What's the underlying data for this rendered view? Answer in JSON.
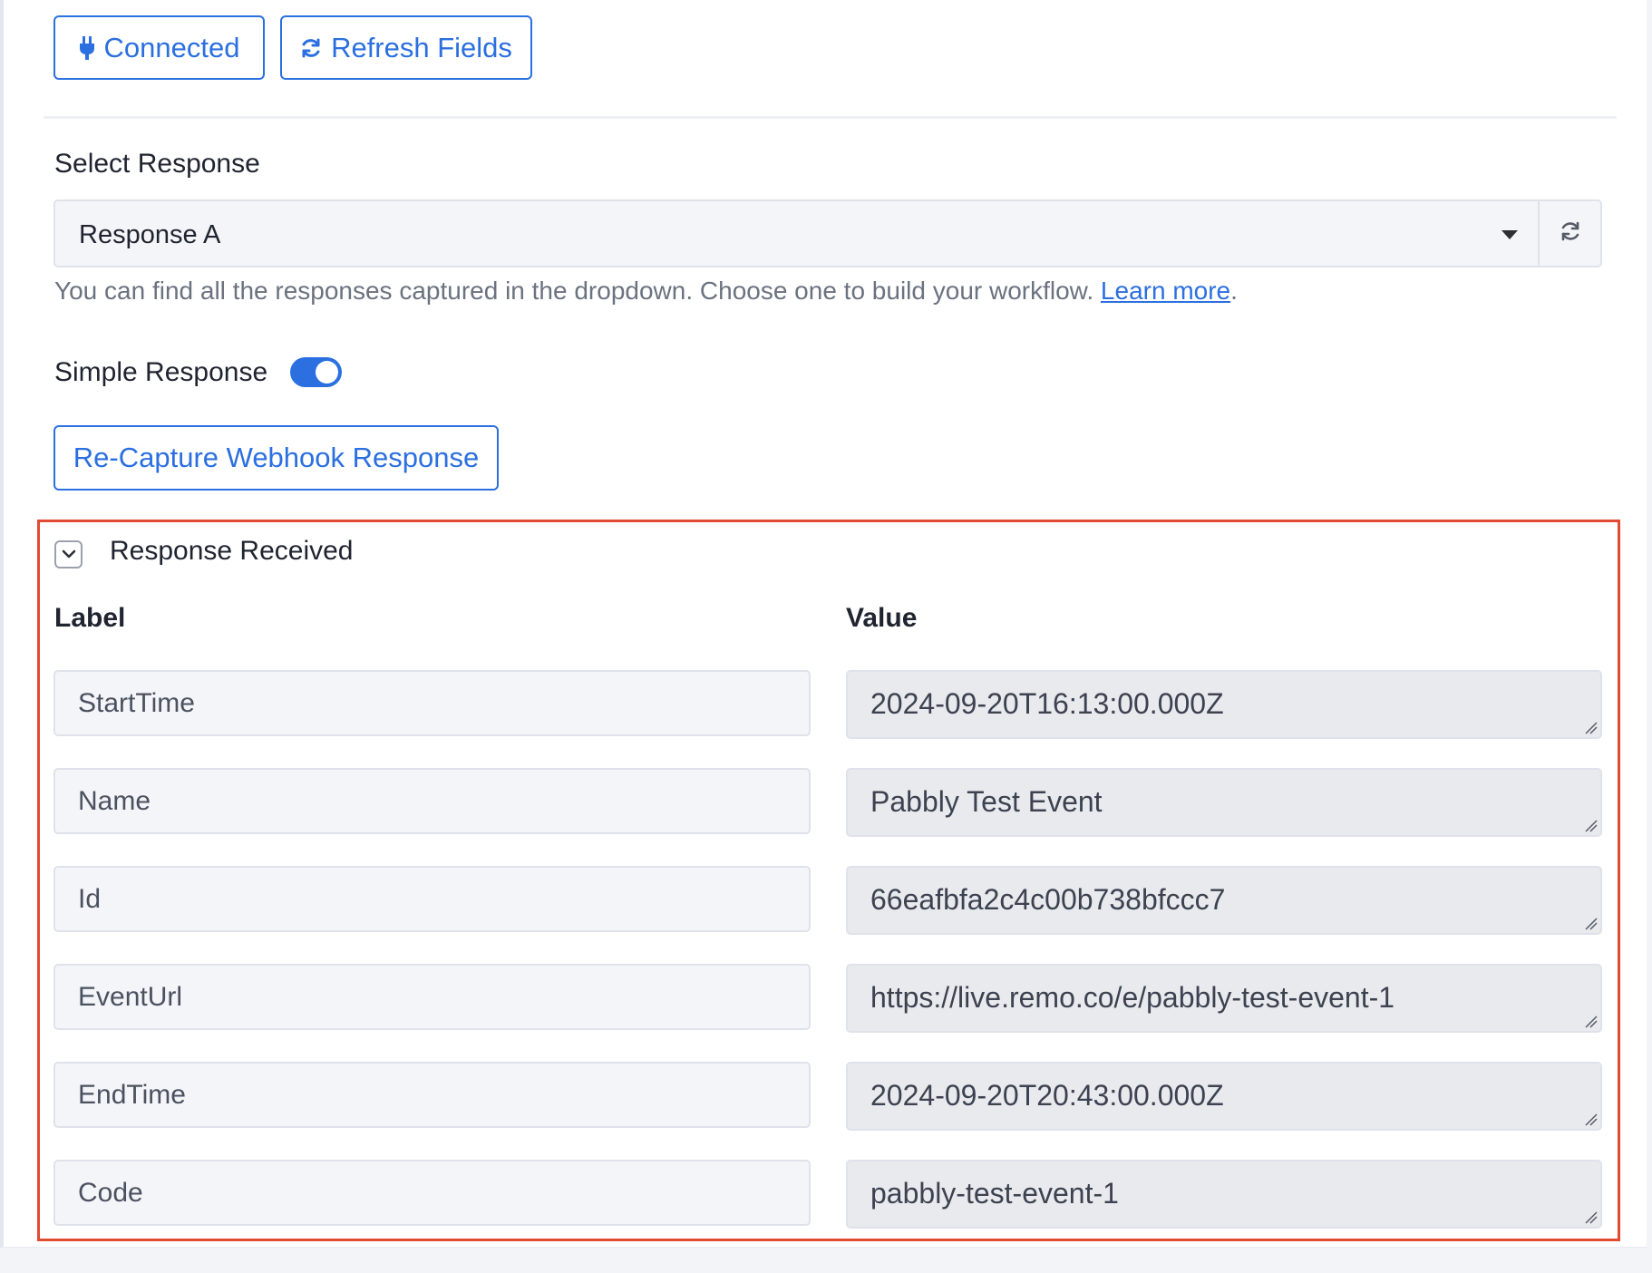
{
  "toolbar": {
    "connected_label": "Connected",
    "connected_icon": "plug-icon",
    "refresh_label": "Refresh Fields",
    "refresh_icon": "refresh-icon"
  },
  "select_response": {
    "label": "Select Response",
    "value": "Response A",
    "help_text": "You can find all the responses captured in the dropdown. Choose one to build your workflow. ",
    "help_link": "Learn more",
    "help_suffix": "."
  },
  "simple_response": {
    "label": "Simple Response",
    "enabled": true
  },
  "recapture_label": "Re-Capture Webhook Response",
  "response_received": {
    "title": "Response Received",
    "expanded": true,
    "columns": {
      "label": "Label",
      "value": "Value"
    },
    "rows": [
      {
        "label": "StartTime",
        "value": "2024-09-20T16:13:00.000Z"
      },
      {
        "label": "Name",
        "value": "Pabbly Test Event"
      },
      {
        "label": "Id",
        "value": "66eafbfa2c4c00b738bfccc7"
      },
      {
        "label": "EventUrl",
        "value": "https://live.remo.co/e/pabbly-test-event-1"
      },
      {
        "label": "EndTime",
        "value": "2024-09-20T20:43:00.000Z"
      },
      {
        "label": "Code",
        "value": "pabbly-test-event-1"
      }
    ]
  },
  "colors": {
    "accent": "#2b6fe0",
    "highlight_border": "#e04a30"
  }
}
